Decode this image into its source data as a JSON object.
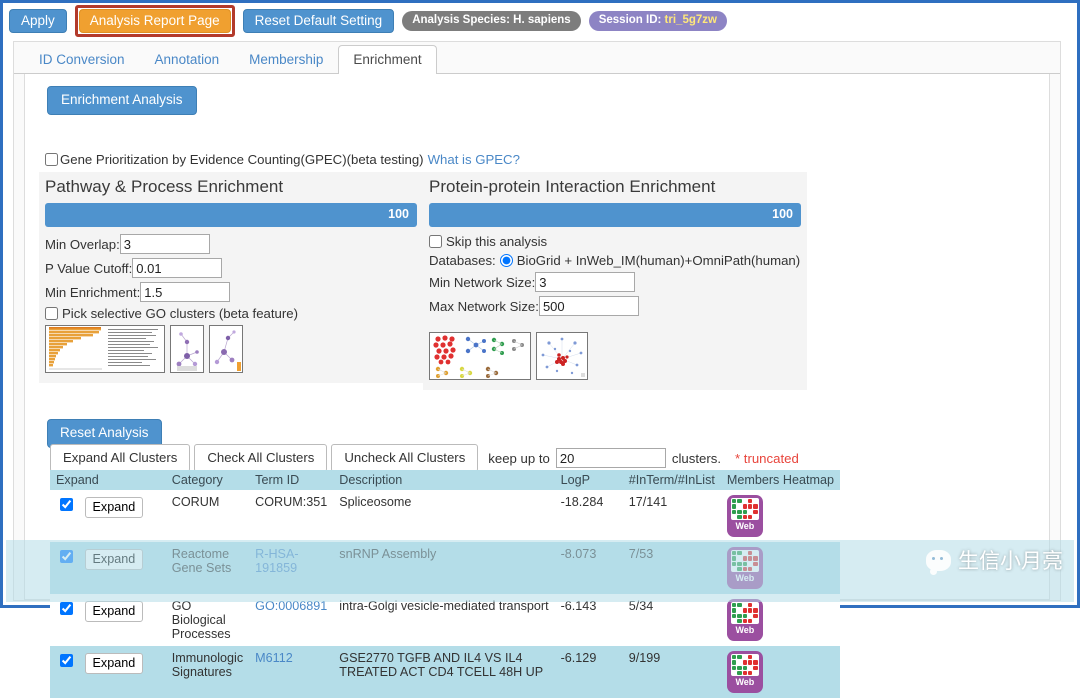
{
  "toolbar": {
    "apply_label": "Apply",
    "report_label": "Analysis Report Page",
    "reset_default_label": "Reset Default Setting",
    "species_badge": "Analysis Species: H. sapiens",
    "session_badge_prefix": "Session ID: ",
    "session_id": "tri_5g7zw"
  },
  "tabs": [
    {
      "label": "ID Conversion",
      "active": false
    },
    {
      "label": "Annotation",
      "active": false
    },
    {
      "label": "Membership",
      "active": false
    },
    {
      "label": "Enrichment",
      "active": true
    }
  ],
  "panel": {
    "enrichment_analysis_button": "Enrichment Analysis",
    "gpec_checkbox_label": "Gene Prioritization by Evidence Counting(GPEC)(beta testing)",
    "gpec_link": "What is GPEC?",
    "reset_analysis_button": "Reset Analysis"
  },
  "pathway_panel": {
    "title": "Pathway & Process Enrichment",
    "progress_value": "100",
    "fields": [
      {
        "label": "Min Overlap:",
        "value": "3"
      },
      {
        "label": "P Value Cutoff:",
        "value": "0.01"
      },
      {
        "label": "Min Enrichment:",
        "value": "1.5"
      }
    ],
    "go_clusters_checkbox": "Pick selective GO clusters (beta feature)",
    "thumbnails": [
      "go-enrichment-barchart-thumbnail",
      "go-network-thumbnail-1",
      "go-network-thumbnail-2"
    ]
  },
  "ppi_panel": {
    "title": "Protein-protein Interaction Enrichment",
    "progress_value": "100",
    "skip_label": "Skip this analysis",
    "databases_label": "Databases:",
    "databases_option": "BioGrid + InWeb_IM(human)+OmniPath(human)",
    "fields": [
      {
        "label": "Min Network Size:",
        "value": "3"
      },
      {
        "label": "Max Network Size:",
        "value": "500"
      }
    ],
    "thumbnails": [
      "ppi-network-panels-thumbnail",
      "ppi-merged-network-thumbnail"
    ]
  },
  "cluster_controls": {
    "expand_all": "Expand All Clusters",
    "check_all": "Check All Clusters",
    "uncheck_all": "Uncheck All Clusters",
    "keep_label": "keep up to",
    "keep_value": "20",
    "clusters_label": "clusters.",
    "truncated_note": "* truncated"
  },
  "table": {
    "headers": [
      "Expand",
      "Category",
      "Term ID",
      "Description",
      "LogP",
      "#InTerm/#InList",
      "Members Heatmap"
    ],
    "expand_button_label": "Expand",
    "heatmap_button_label": "Web",
    "rows": [
      {
        "checked": true,
        "category": "CORUM",
        "term_id": "CORUM:351",
        "term_is_link": false,
        "description": "Spliceosome",
        "logp": "-18.284",
        "in_term_in_list": "17/141"
      },
      {
        "checked": true,
        "category": "Reactome Gene Sets",
        "term_id": "R-HSA-191859",
        "term_is_link": true,
        "description": "snRNP Assembly",
        "logp": "-8.073",
        "in_term_in_list": "7/53"
      },
      {
        "checked": true,
        "category": "GO Biological Processes",
        "term_id": "GO:0006891",
        "term_is_link": true,
        "description": "intra-Golgi vesicle-mediated transport",
        "logp": "-6.143",
        "in_term_in_list": "5/34"
      },
      {
        "checked": true,
        "category": "Immunologic Signatures",
        "term_id": "M6112",
        "term_is_link": true,
        "description": "GSE2770 TGFB AND IL4 VS IL4 TREATED ACT CD4 TCELL 48H UP",
        "logp": "-6.129",
        "in_term_in_list": "9/199"
      }
    ]
  },
  "watermark": {
    "text": "生信小月亮",
    "icon": "wechat-icon"
  },
  "colors": {
    "accent_blue": "#4f93ce",
    "highlight_orange": "#f0a030",
    "highlight_border_red": "#b33a2b",
    "row_alt_blue": "#b4dde8",
    "link_blue": "#4a88c7",
    "truncated_red": "#e8453c",
    "heatmap_purple": "#9b4fa0",
    "session_pill_purple": "#8d84c4",
    "species_pill_gray": "#7d7d7d"
  }
}
